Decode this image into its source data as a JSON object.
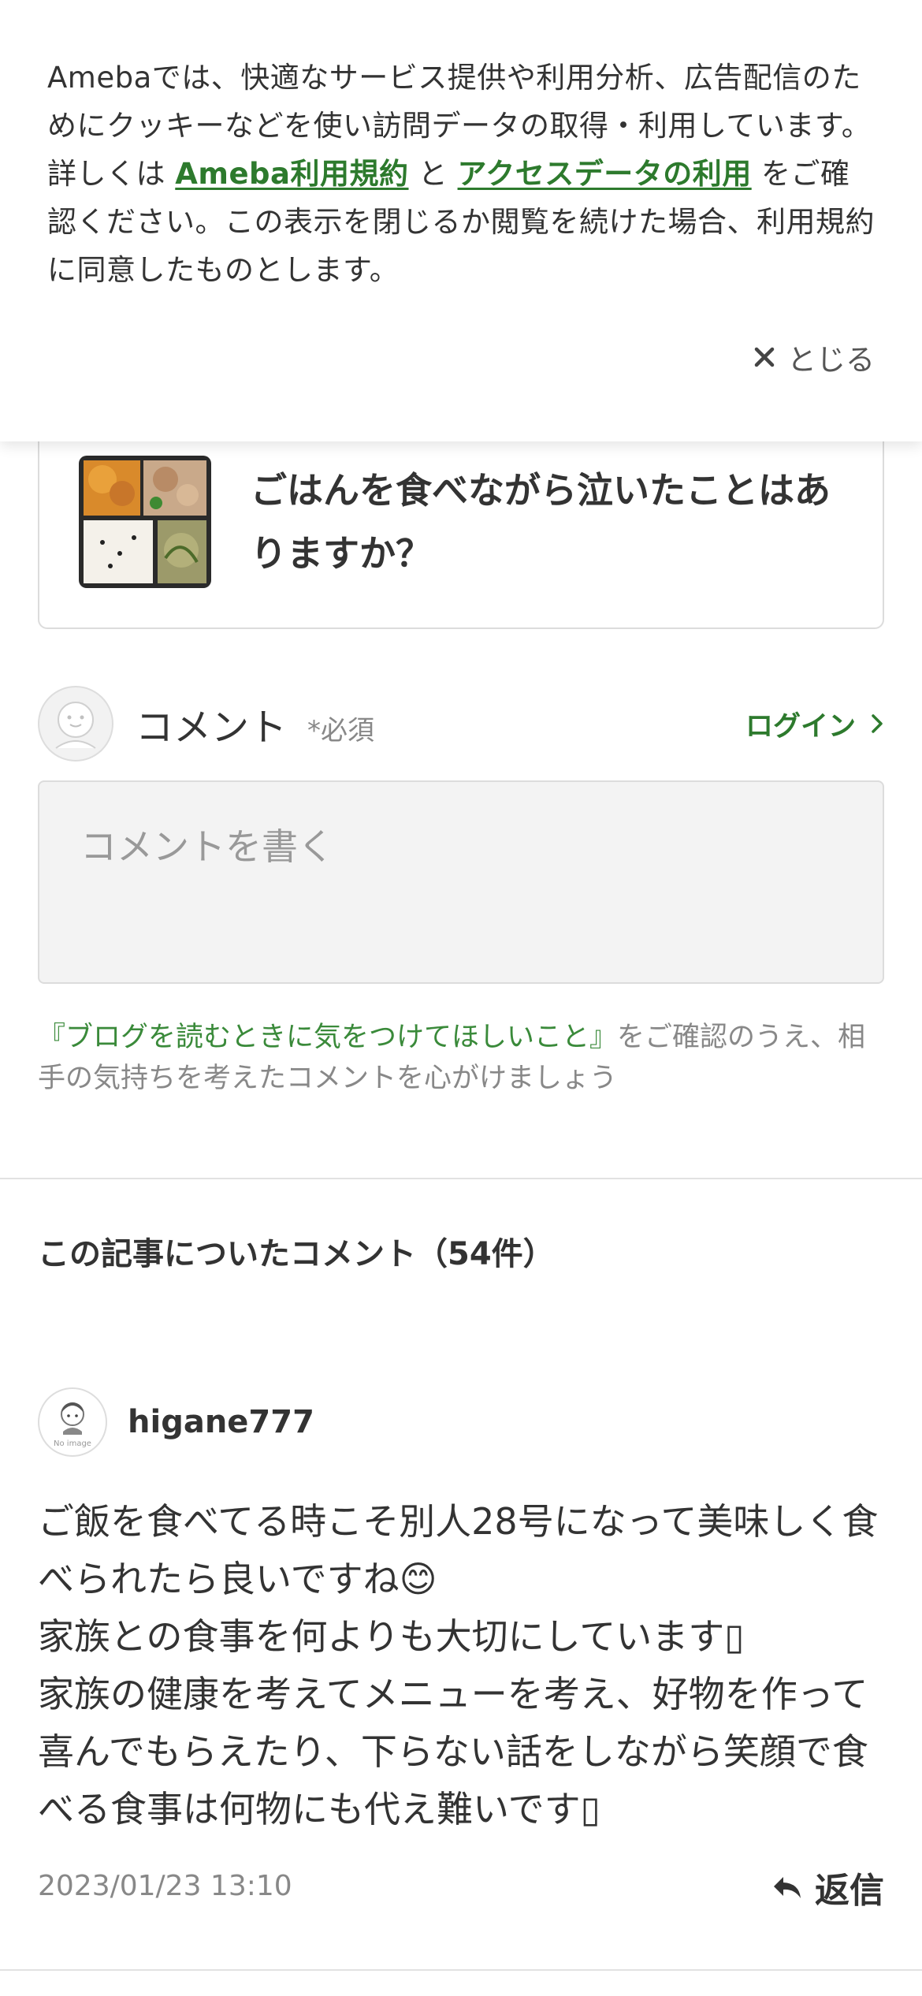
{
  "cookie_banner": {
    "text_before": "Amebaでは、快適なサービス提供や利用分析、広告配信のためにクッキーなどを使い訪問データの取得・利用しています。詳しくは",
    "link_terms": "Ameba利用規約",
    "text_and": "と",
    "link_access_data": "アクセスデータの利用",
    "text_after": "をご確認ください。この表示を閉じるか閲覧を続けた場合、利用規約に同意したものとします。",
    "close_label": "とじる",
    "close_icon": "close-icon"
  },
  "article": {
    "title": "ごはんを食べながら泣いたことはありますか？",
    "thumbnail": "bento-photo"
  },
  "comment_form": {
    "label": "コメント",
    "required": "*必須",
    "login_label": "ログイン",
    "login_icon": "chevron-right-icon",
    "placeholder": "コメントを書く",
    "avatar_icon": "default-avatar-icon"
  },
  "guideline": {
    "link": "『ブログを読むときに気をつけてほしいこと』",
    "text": "をご確認のうえ、相手の気持ちを考えたコメントを心がけましょう"
  },
  "comments": {
    "heading": "この記事についたコメント（54件）",
    "items": [
      {
        "author": "higane777",
        "avatar": "no-image-avatar",
        "avatar_caption": "No image",
        "body": "ご飯を食べてる時こそ別人28号になって美味しく食べられたら良いですね😊\n家族との食事を何よりも大切にしています▯\n家族の健康を考えてメニューを考え、好物を作って喜んでもらえたり、下らない話をしながら笑顔で食べる食事は何物にも代え難いです▯",
        "date": "2023/01/23 13:10",
        "reply_label": "返信",
        "reply_icon": "reply-icon"
      }
    ]
  },
  "colors": {
    "link_green": "#2d7a2d",
    "text": "#333333",
    "muted": "#888888",
    "border": "#dcdcdc"
  }
}
